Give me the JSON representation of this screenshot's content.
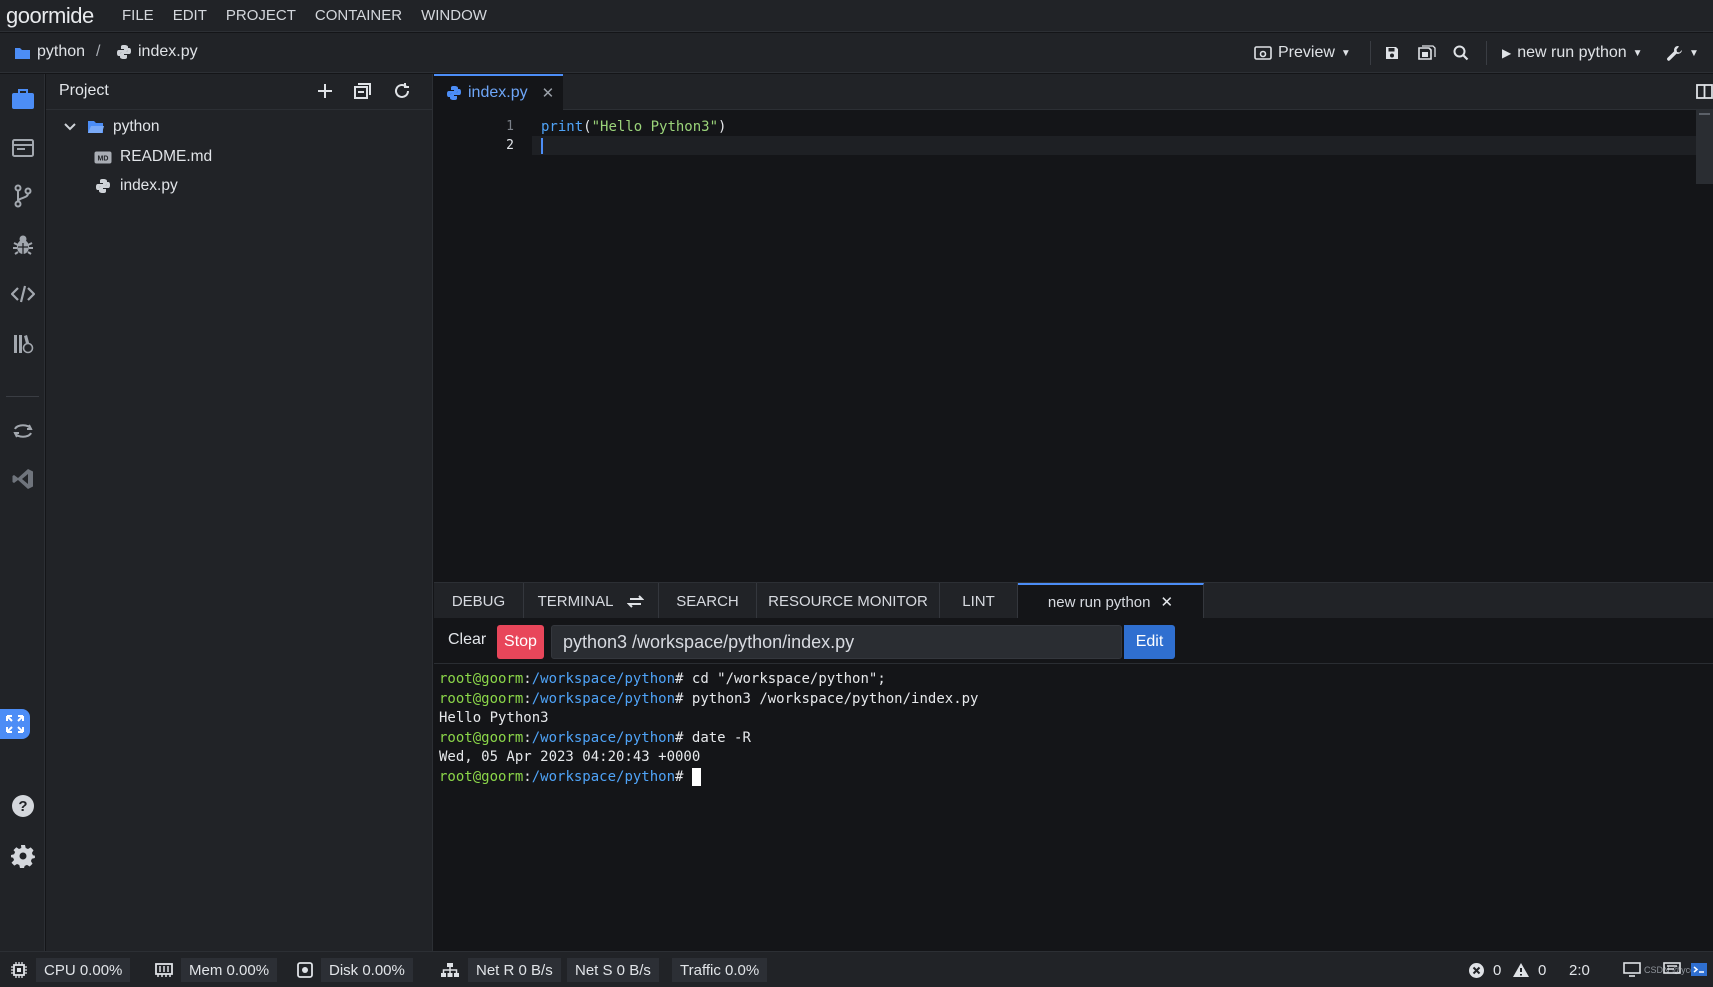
{
  "app": {
    "logo": "goormide",
    "menu": [
      "FILE",
      "EDIT",
      "PROJECT",
      "CONTAINER",
      "WINDOW"
    ]
  },
  "breadcrumb": {
    "project": "python",
    "separator": "/",
    "file": "index.py"
  },
  "toolbar": {
    "preview_label": "Preview",
    "run_config_label": "new run python"
  },
  "sidebar": {
    "title": "Project",
    "tree": {
      "folder": "python",
      "files": [
        "README.md",
        "index.py"
      ]
    }
  },
  "editor": {
    "tab_label": "index.py",
    "lines": [
      {
        "num": "1",
        "fn": "print",
        "open": "(",
        "str": "\"Hello Python3\"",
        "close": ")"
      },
      {
        "num": "2"
      }
    ]
  },
  "panel": {
    "tabs": [
      "DEBUG",
      "TERMINAL",
      "SEARCH",
      "RESOURCE MONITOR",
      "LINT"
    ],
    "active_tab": "new run python",
    "clear_label": "Clear",
    "stop_label": "Stop",
    "command": "python3 /workspace/python/index.py",
    "edit_label": "Edit"
  },
  "terminal": {
    "user": "root@goorm",
    "colon": ":",
    "path": "/workspace/python",
    "prompt": "#",
    "cmd1": " cd \"/workspace/python\";",
    "cmd2": " python3 /workspace/python/index.py",
    "out1": "Hello Python3",
    "cmd3": " date -R",
    "out2": "Wed, 05 Apr 2023 04:20:43 +0000"
  },
  "status": {
    "cpu": "CPU 0.00%",
    "mem": "Mem 0.00%",
    "disk": "Disk 0.00%",
    "net_r": "Net R 0 B/s",
    "net_s": "Net S 0 B/s",
    "traffic": "Traffic 0.0%",
    "errors": "0",
    "warnings": "0",
    "cursor": "2:0",
    "watermark": "CSDN @ycdn"
  },
  "colors": {
    "accent": "#4c8df6",
    "stop": "#e8465a",
    "edit": "#2f6fd0",
    "prompt_user": "#8bd649",
    "prompt_path": "#4fa3f7"
  }
}
